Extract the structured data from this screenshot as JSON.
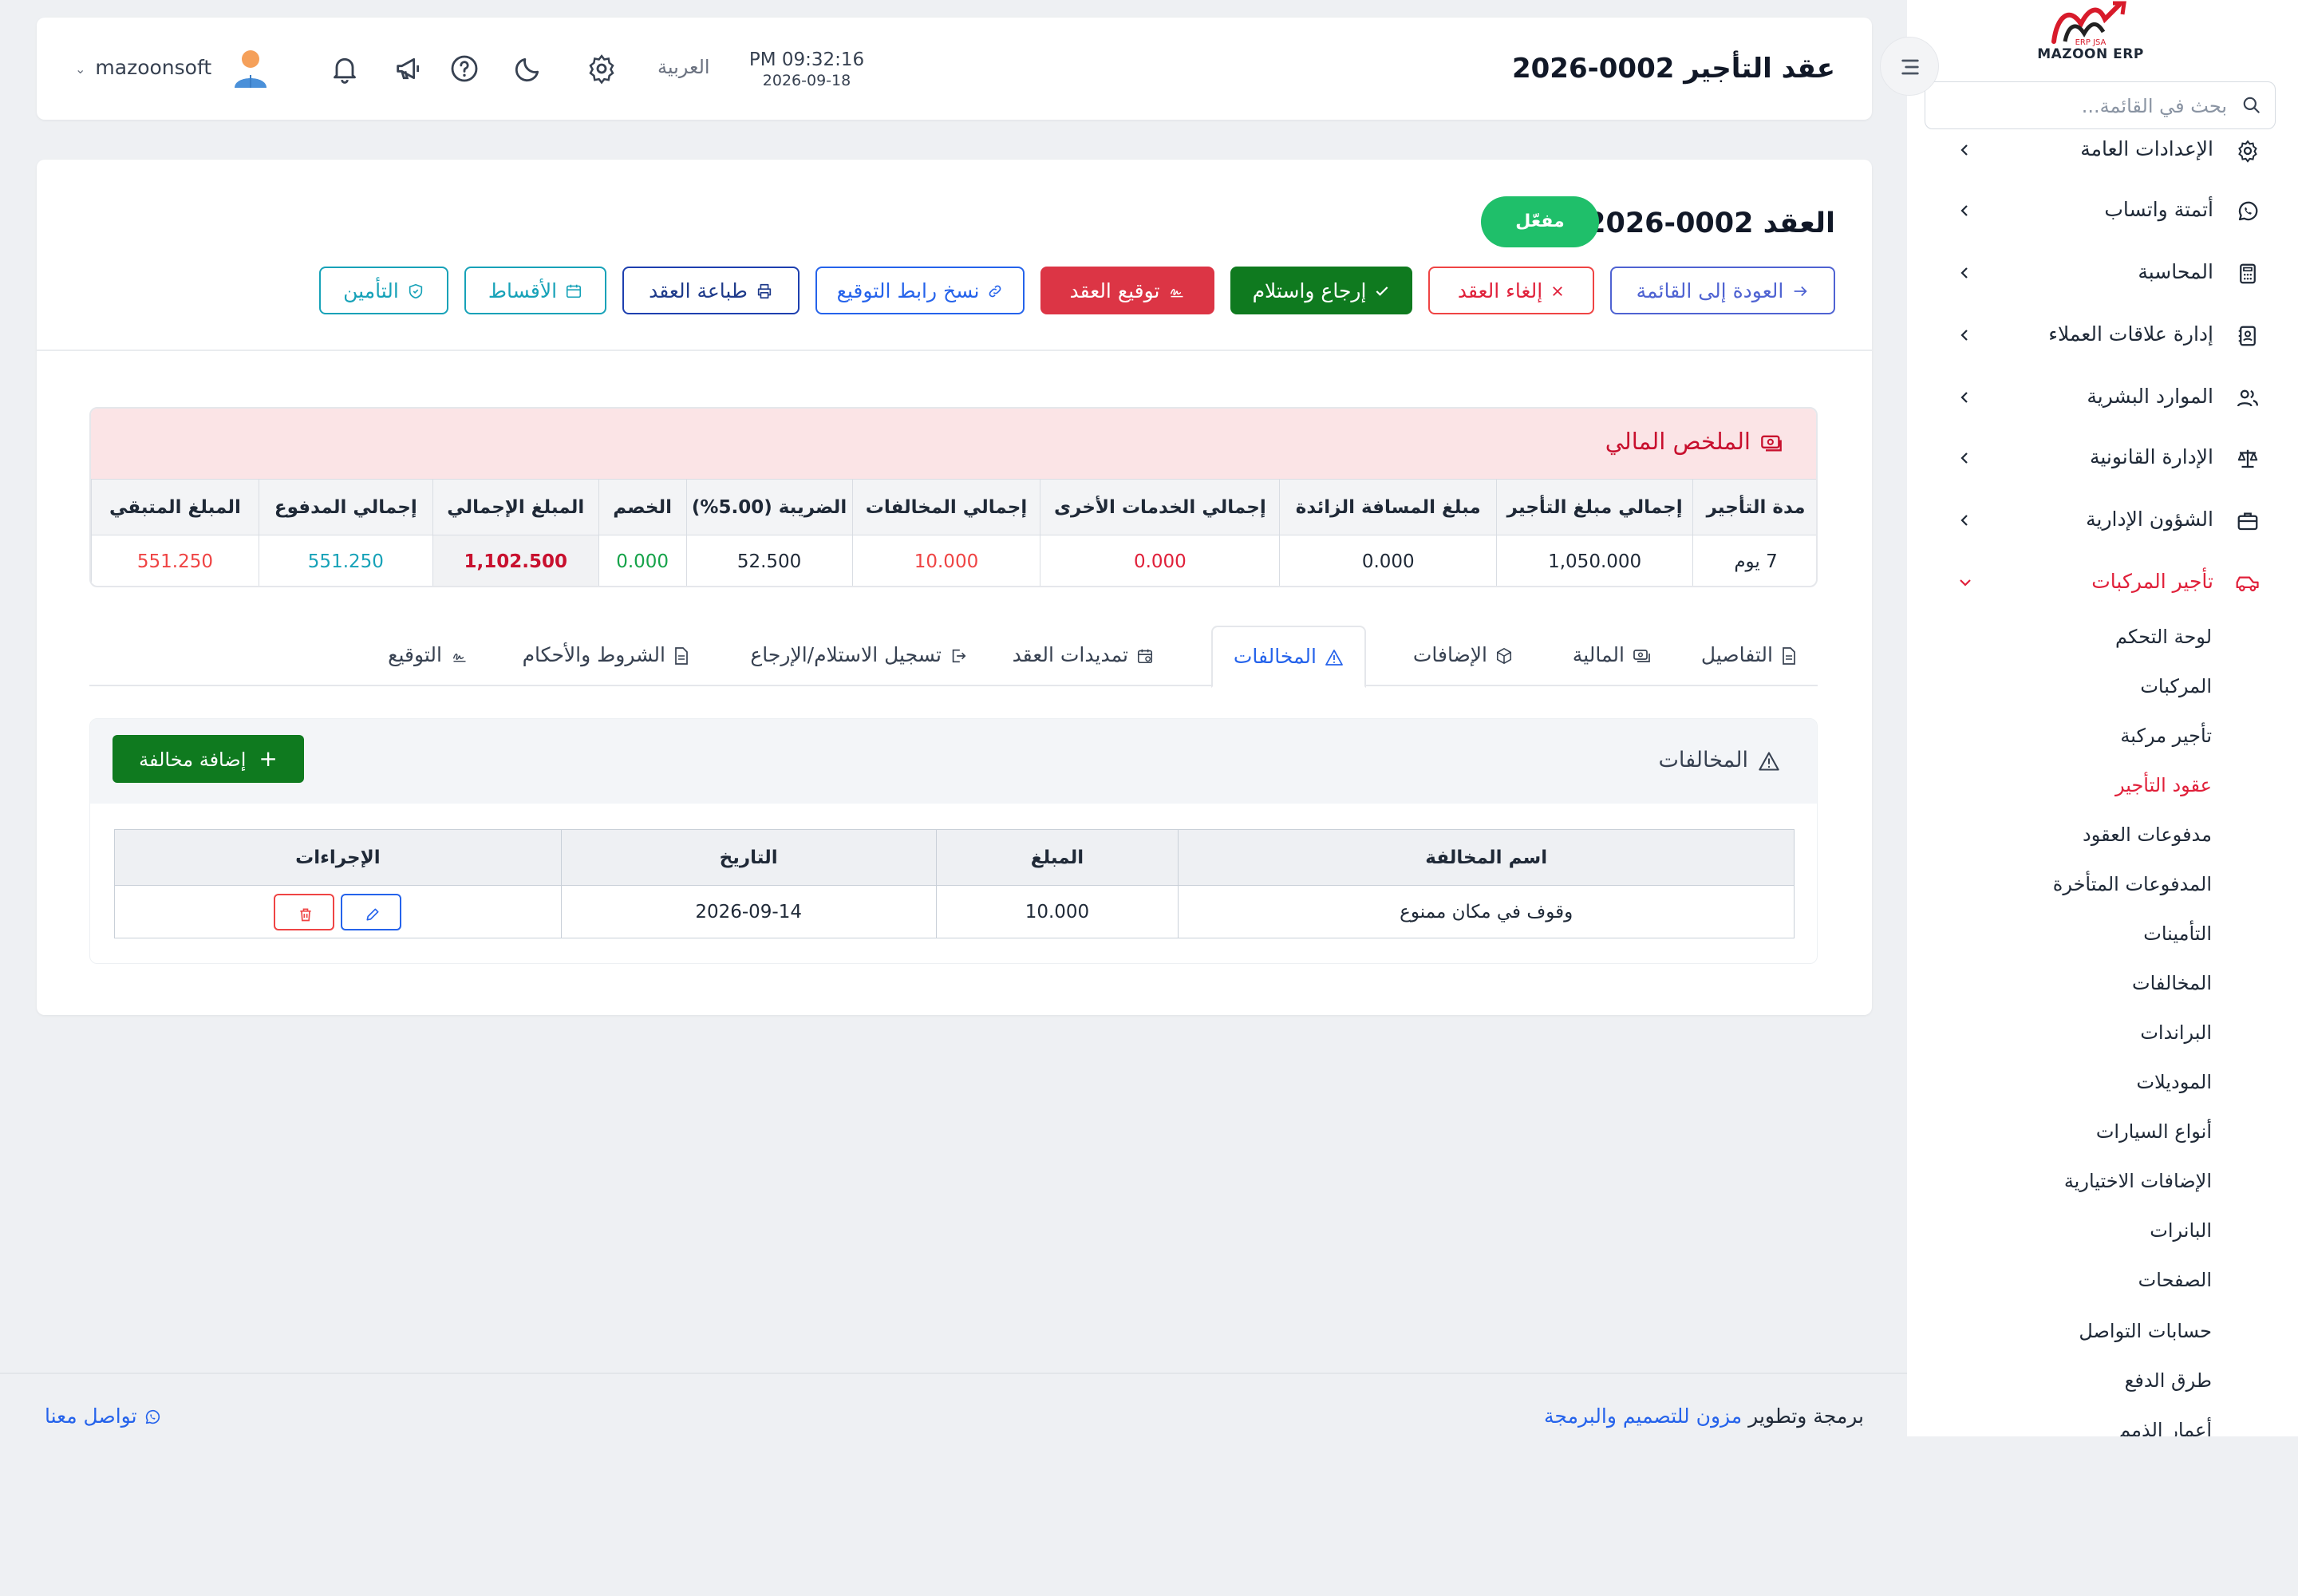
{
  "sidebar": {
    "brand_top": "ERP JSA",
    "brand": "MAZOON ERP",
    "search_placeholder": "بحث في القائمة...",
    "menu": [
      {
        "label": "الإعدادات العامة",
        "icon": "gear-icon"
      },
      {
        "label": "أتمتة واتساب",
        "icon": "whatsapp-icon"
      },
      {
        "label": "المحاسبة",
        "icon": "calculator-icon"
      },
      {
        "label": "إدارة علاقات العملاء",
        "icon": "contacts-icon"
      },
      {
        "label": "الموارد البشرية",
        "icon": "users-icon"
      },
      {
        "label": "الإدارة القانونية",
        "icon": "scale-icon"
      },
      {
        "label": "الشؤون الإدارية",
        "icon": "briefcase-icon"
      },
      {
        "label": "تأجير المركبات",
        "icon": "car-icon"
      }
    ],
    "submenu": [
      "لوحة التحكم",
      "المركبات",
      "تأجير مركبة",
      "عقود التأجير",
      "مدفوعات العقود",
      "المدفوعات المتأخرة",
      "التأمينات",
      "المخالفات",
      "البراندات",
      "الموديلات",
      "أنواع السيارات",
      "الإضافات الاختيارية",
      "البانرات",
      "الصفحات",
      "حسابات التواصل",
      "طرق الدفع",
      "أعمار الذمم"
    ],
    "active_submenu": "عقود التأجير"
  },
  "header": {
    "title": "عقد التأجير 0002-2026",
    "time": "PM 09:32:16",
    "date": "2026-09-18",
    "language": "العربية",
    "username": "mazoonsoft"
  },
  "contract": {
    "title": "العقد 0002-2026",
    "status": "مفعّل",
    "buttons": {
      "back": "العودة إلى القائمة",
      "cancel": "إلغاء العقد",
      "return": "إرجاع واستلام",
      "sign": "توقيع العقد",
      "copy_link": "نسخ رابط التوقيع",
      "print": "طباعة العقد",
      "installments": "الأقساط",
      "insurance": "التأمين"
    }
  },
  "financial_summary": {
    "title": "الملخص المالي",
    "headers": [
      "مدة التأجير",
      "إجمالي مبلغ التأجير",
      "مبلغ المسافة الزائدة",
      "إجمالي الخدمات الأخرى",
      "إجمالي المخالفات",
      "الضريبة (5.00%)",
      "الخصم",
      "المبلغ الإجمالي",
      "إجمالي المدفوع",
      "المبلغ المتبقي"
    ],
    "values": [
      "7 يوم",
      "1,050.000",
      "0.000",
      "0.000",
      "10.000",
      "52.500",
      "0.000",
      "1,102.500",
      "551.250",
      "551.250"
    ]
  },
  "tabs": [
    {
      "label": "التفاصيل",
      "icon": "document-icon"
    },
    {
      "label": "المالية",
      "icon": "money-icon"
    },
    {
      "label": "الإضافات",
      "icon": "box-icon"
    },
    {
      "label": "المخالفات",
      "icon": "warning-icon"
    },
    {
      "label": "تمديدات العقد",
      "icon": "calendar-icon"
    },
    {
      "label": "تسجيل الاستلام/الإرجاع",
      "icon": "exit-icon"
    },
    {
      "label": "الشروط والأحكام",
      "icon": "document-icon"
    },
    {
      "label": "التوقيع",
      "icon": "signature-icon"
    }
  ],
  "active_tab": "المخالفات",
  "violations": {
    "title": "المخالفات",
    "add_button": "إضافة مخالفة",
    "headers": [
      "اسم المخالفة",
      "المبلغ",
      "التاريخ",
      "الإجراءات"
    ],
    "rows": [
      {
        "name": "وقوف في مكان ممنوع",
        "amount": "10.000",
        "date": "2026-09-14"
      }
    ]
  },
  "footer": {
    "credit_prefix": "برمجة وتطوير",
    "credit_link": "مزون للتصميم والبرمجة",
    "contact": "تواصل معنا"
  },
  "colors": {
    "accent_blue": "#2563eb",
    "danger": "#e0203a",
    "success_green": "#0f7a1f",
    "status_badge": "#1fbf6a",
    "teal": "#17a2b8",
    "summary_header_bg": "#fbe4e6"
  }
}
